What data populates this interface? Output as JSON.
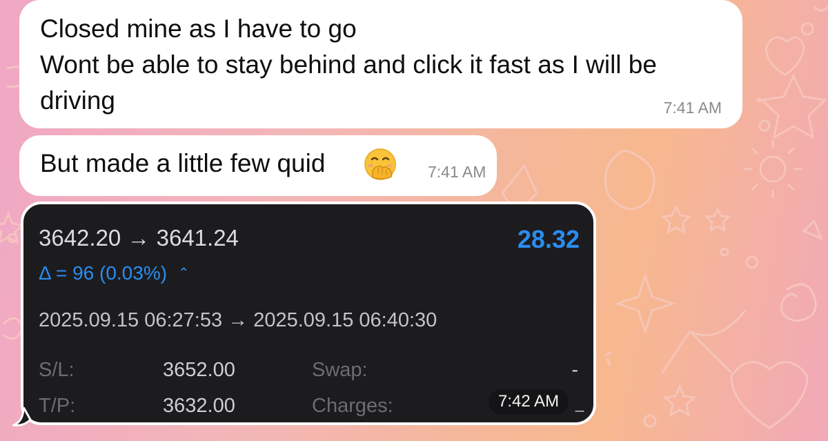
{
  "messages": [
    {
      "lines": [
        "Closed mine as I have to go",
        "Wont be able to stay behind and click it fast as I will be",
        "driving"
      ],
      "time": "7:41 AM"
    },
    {
      "text": "But made a little few quid",
      "emoji": "face-with-hand-over-mouth",
      "time": "7:41 AM"
    }
  ],
  "trade_card": {
    "price_range": "3642.20 → 3641.24",
    "profit": "28.32",
    "delta": "Δ = 96 (0.03%)",
    "date_range": "2025.09.15 06:27:53 → 2025.09.15 06:40:30",
    "sl_label": "S/L:",
    "sl_value": "3652.00",
    "swap_label": "Swap:",
    "swap_value": "-",
    "tp_label": "T/P:",
    "tp_value": "3632.00",
    "charges_label": "Charges:",
    "time": "7:42 AM",
    "accent_color": "#2a8df0"
  }
}
